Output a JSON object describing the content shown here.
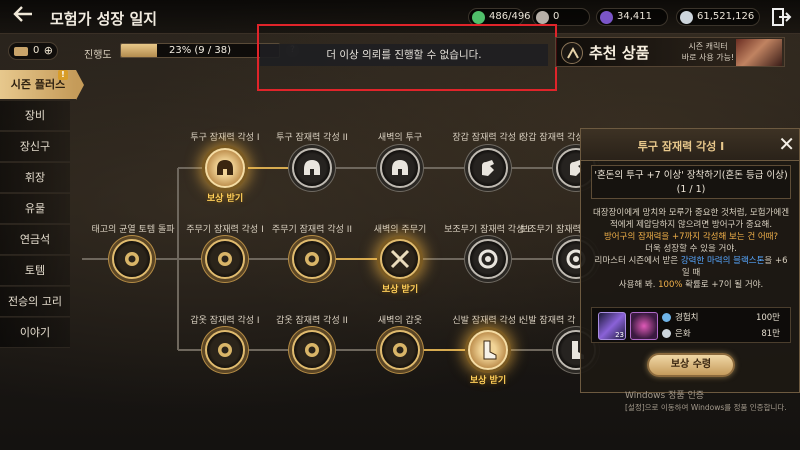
{
  "header": {
    "title": "모험가 성장 일지",
    "currencies": [
      {
        "value": "486/496",
        "icon": "energy-icon",
        "color": "#4fbf6a"
      },
      {
        "value": "0",
        "icon": "pearl-icon",
        "color": "#b7b0a8"
      },
      {
        "value": "34,411",
        "icon": "crystal-icon",
        "color": "#7a55c8"
      },
      {
        "value": "61,521,126",
        "icon": "silver-icon",
        "color": "#cdd5dc"
      }
    ]
  },
  "subbar": {
    "ticket_count": "0",
    "progress_label": "진행도",
    "progress_text": "23% (9 / 38)",
    "progress_percent": 23
  },
  "notice": "더 이상 의뢰를 진행할 수 없습니다.",
  "recommend": {
    "title": "추천 상품",
    "subtitle_1": "시즌 캐릭터",
    "subtitle_2": "바로 사용 가능!"
  },
  "sidebar": {
    "items": [
      {
        "label": "시즌 플러스",
        "active": true
      },
      {
        "label": "장비"
      },
      {
        "label": "장신구"
      },
      {
        "label": "휘장"
      },
      {
        "label": "유물"
      },
      {
        "label": "연금석"
      },
      {
        "label": "토템"
      },
      {
        "label": "전승의 고리"
      },
      {
        "label": "이야기"
      }
    ],
    "badge": "!"
  },
  "tree": {
    "root_label": "태고의 균열 토템 돌파",
    "row1": [
      "투구 잠재력 각성 I",
      "투구 잠재력 각성 II",
      "새벽의 투구",
      "장갑 잠재력 각성 I",
      "장갑 잠재력 각성"
    ],
    "row2": [
      "주무기 잠재력 각성 I",
      "주무기 잠재력 각성 II",
      "새벽의 주무기",
      "보조무기 잠재력 각성 I",
      "보조무기 잠재력 각"
    ],
    "row3": [
      "갑옷 잠재력 각성 I",
      "갑옷 잠재력 각성 II",
      "새벽의 갑옷",
      "신발 잠재력 각성 I",
      "신발 잠재력 각"
    ],
    "reward_label": "보상 받기"
  },
  "panel": {
    "title": "투구 잠재력 각성 I",
    "mission_line1": "'혼돈의 투구 +7 이상' 장착하기(혼돈 등급 이상)",
    "mission_line2": "(1 / 1)",
    "desc_1": "대장장이에게 망치와 모루가 중요한 것처럼, 모험가에겐",
    "desc_2": "적에게 제압당하지 않으려면 방어구가 중요해.",
    "desc_3": "방어구의 잠재력을 +7까지 각성해 보는 건 어때?",
    "desc_4": "더욱 성장할 수 있을 거야.",
    "desc_5a": "리마스터 시즌에서 받은 ",
    "desc_5b": "강력한 마력의 블랙스톤",
    "desc_5c": "을 +6일 때",
    "desc_6a": "사용해 봐. ",
    "desc_6b": "100%",
    "desc_6c": " 확률로 +7이 될 거야.",
    "reward_item_count": "23",
    "rewards": [
      {
        "name": "경험치",
        "value": "100만",
        "icon": "exp-icon"
      },
      {
        "name": "은화",
        "value": "81만",
        "icon": "silver-coin-icon"
      }
    ],
    "claim_label": "보상 수령"
  },
  "watermark": {
    "line1": "Windows 정품 인증",
    "line2": "[설정]으로 이동하여 Windows를 정품 인증합니다."
  }
}
